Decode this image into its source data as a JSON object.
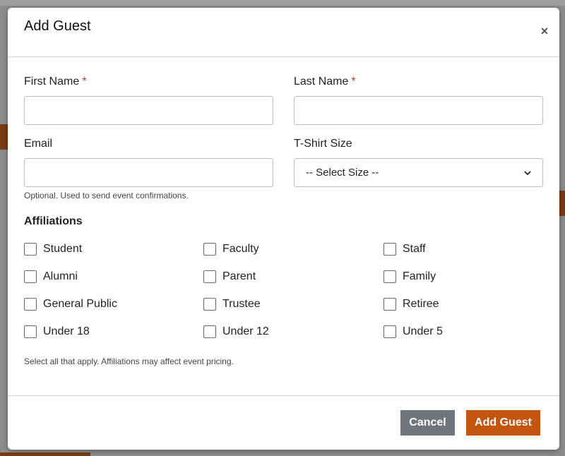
{
  "modal": {
    "title": "Add Guest",
    "close_glyph": "×"
  },
  "form": {
    "first_name": {
      "label": "First Name",
      "required_mark": "*",
      "value": ""
    },
    "last_name": {
      "label": "Last Name",
      "required_mark": "*",
      "value": ""
    },
    "email": {
      "label": "Email",
      "value": "",
      "help": "Optional. Used to send event confirmations."
    },
    "tshirt": {
      "label": "T-Shirt Size",
      "selected": "-- Select Size --"
    }
  },
  "affiliations": {
    "title": "Affiliations",
    "items": [
      {
        "label": "Student",
        "checked": false
      },
      {
        "label": "Faculty",
        "checked": false
      },
      {
        "label": "Staff",
        "checked": false
      },
      {
        "label": "Alumni",
        "checked": false
      },
      {
        "label": "Parent",
        "checked": false
      },
      {
        "label": "Family",
        "checked": false
      },
      {
        "label": "General Public",
        "checked": false
      },
      {
        "label": "Trustee",
        "checked": false
      },
      {
        "label": "Retiree",
        "checked": false
      },
      {
        "label": "Under 18",
        "checked": false
      },
      {
        "label": "Under 12",
        "checked": false
      },
      {
        "label": "Under 5",
        "checked": false
      }
    ],
    "help": "Select all that apply. Affiliations may affect event pricing."
  },
  "footer": {
    "cancel_label": "Cancel",
    "submit_label": "Add Guest"
  },
  "colors": {
    "primary": "#c4550f",
    "secondary": "#6e757c",
    "required": "#c0392b"
  },
  "icons": {
    "close": "close-icon",
    "select": "chevron-down-icon"
  }
}
